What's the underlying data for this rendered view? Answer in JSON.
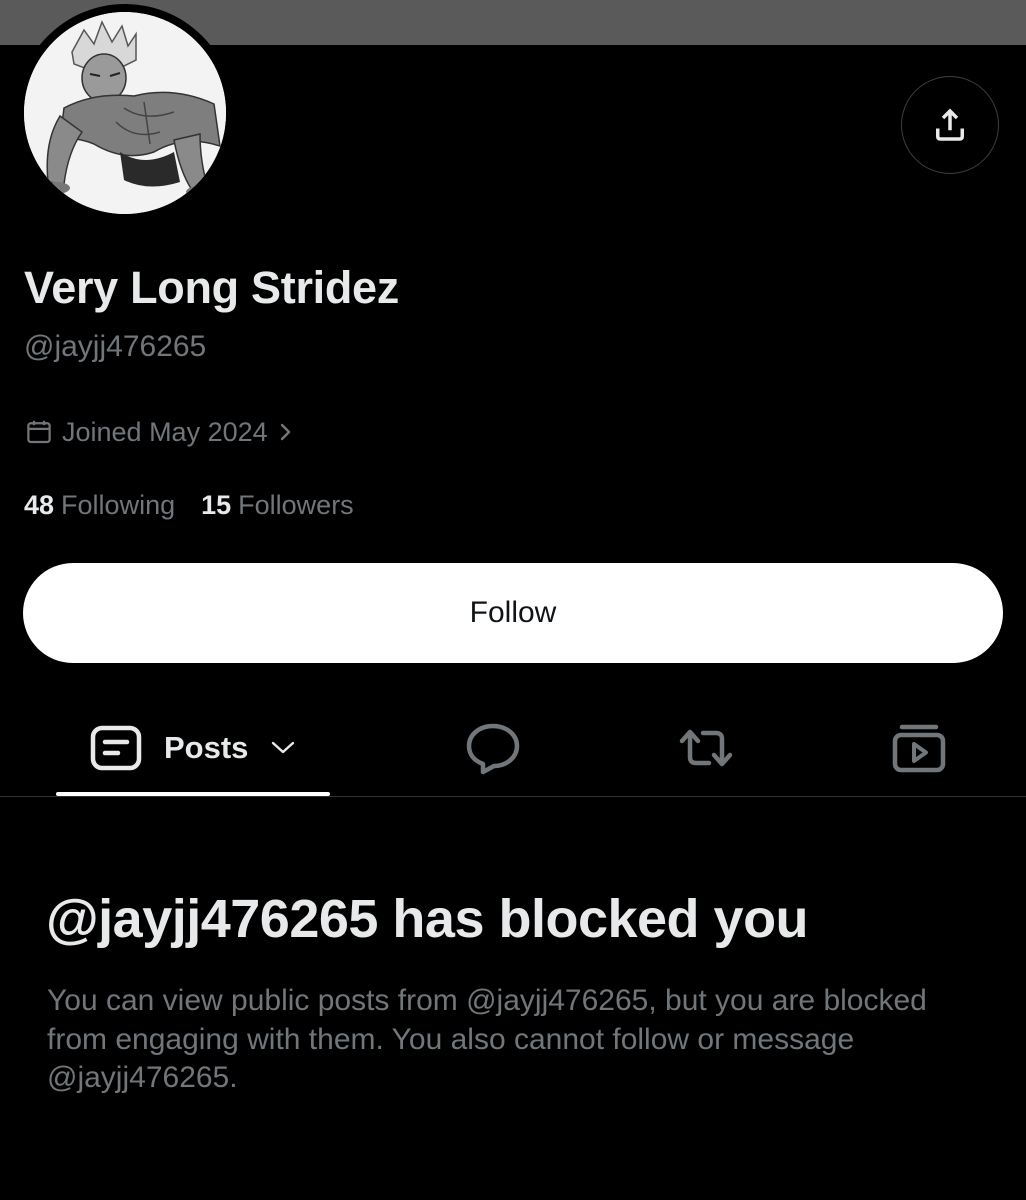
{
  "profile": {
    "display_name": "Very Long Stridez",
    "handle": "@jayjj476265",
    "joined": "Joined May 2024",
    "following_count": "48",
    "following_label": "Following",
    "followers_count": "15",
    "followers_label": "Followers"
  },
  "actions": {
    "follow_label": "Follow",
    "share_icon": "share-icon"
  },
  "tabs": [
    {
      "label": "Posts",
      "icon": "posts-icon",
      "selected": true
    },
    {
      "label": "",
      "icon": "replies-icon",
      "selected": false
    },
    {
      "label": "",
      "icon": "reposts-icon",
      "selected": false
    },
    {
      "label": "",
      "icon": "media-icon",
      "selected": false
    }
  ],
  "blocked": {
    "title": "@jayjj476265 has blocked you",
    "message": "You can view public posts from @jayjj476265, but you are blocked from engaging with them. You also cannot follow or message @jayjj476265."
  },
  "colors": {
    "background": "#000000",
    "banner": "#5a5a5a",
    "primary_text": "#e7e9ea",
    "secondary_text": "#71767b",
    "follow_button": "#ffffff"
  }
}
